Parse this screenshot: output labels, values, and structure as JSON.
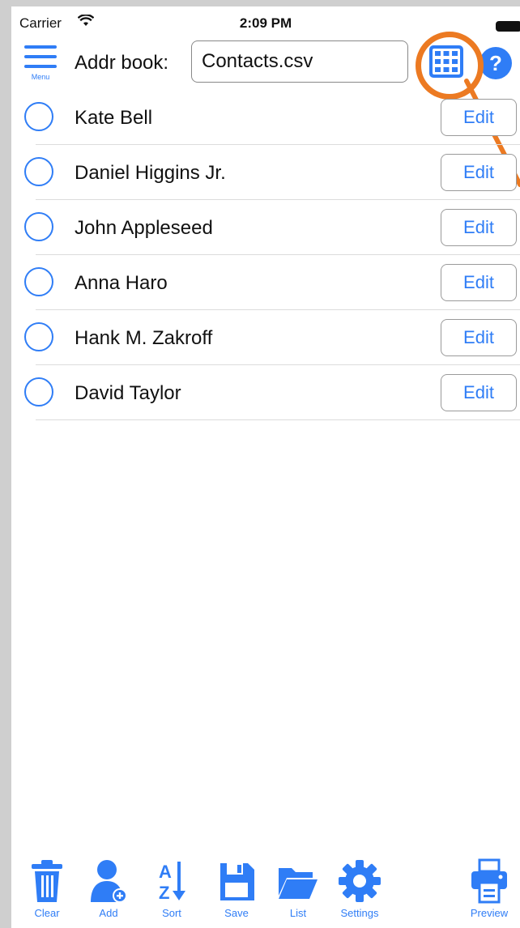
{
  "status_bar": {
    "carrier": "Carrier",
    "time": "2:09 PM"
  },
  "header": {
    "menu_label": "Menu",
    "addr_label": "Addr book:",
    "file_value": "Contacts.csv",
    "help_label": "?"
  },
  "contacts": [
    {
      "name": "Kate Bell",
      "edit_label": "Edit"
    },
    {
      "name": "Daniel Higgins Jr.",
      "edit_label": "Edit"
    },
    {
      "name": "John Appleseed",
      "edit_label": "Edit"
    },
    {
      "name": "Anna Haro",
      "edit_label": "Edit"
    },
    {
      "name": "Hank M. Zakroff",
      "edit_label": "Edit"
    },
    {
      "name": "David Taylor",
      "edit_label": "Edit"
    }
  ],
  "toolbar": {
    "clear": "Clear",
    "add": "Add",
    "sort": "Sort",
    "save": "Save",
    "list": "List",
    "settings": "Settings",
    "preview": "Preview"
  },
  "icons": {
    "grid": "grid-icon",
    "help": "help-icon",
    "trash": "trash-icon",
    "add_user": "add-user-icon",
    "sort": "sort-az-icon",
    "save": "floppy-icon",
    "folder": "folder-icon",
    "gear": "gear-icon",
    "printer": "printer-icon"
  },
  "colors": {
    "accent": "#2f7df6",
    "highlight": "#ec7a22"
  }
}
